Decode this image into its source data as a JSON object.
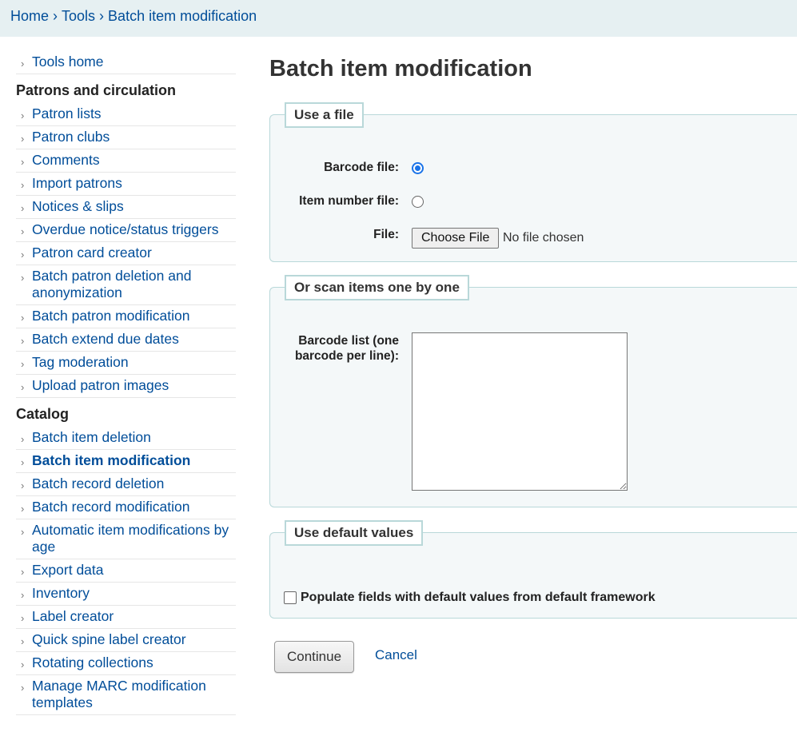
{
  "breadcrumbs": [
    "Home",
    "Tools",
    "Batch item modification"
  ],
  "breadcrumb_separator": "›",
  "sidebar": {
    "tools_home": "Tools home",
    "sections": [
      {
        "heading": "Patrons and circulation",
        "items": [
          "Patron lists",
          "Patron clubs",
          "Comments",
          "Import patrons",
          "Notices & slips",
          "Overdue notice/status triggers",
          "Patron card creator",
          "Batch patron deletion and anonymization",
          "Batch patron modification",
          "Batch extend due dates",
          "Tag moderation",
          "Upload patron images"
        ]
      },
      {
        "heading": "Catalog",
        "items": [
          "Batch item deletion",
          "Batch item modification",
          "Batch record deletion",
          "Batch record modification",
          "Automatic item modifications by age",
          "Export data",
          "Inventory",
          "Label creator",
          "Quick spine label creator",
          "Rotating collections",
          "Manage MARC modification templates"
        ]
      }
    ],
    "active_item": "Batch item modification"
  },
  "page": {
    "title": "Batch item modification",
    "use_file": {
      "legend": "Use a file",
      "barcode_file_label": "Barcode file:",
      "item_number_file_label": "Item number file:",
      "file_label": "File:",
      "choose_file_button": "Choose File",
      "no_file_text": "No file chosen",
      "selected": "barcode"
    },
    "scan": {
      "legend": "Or scan items one by one",
      "barcode_list_label": "Barcode list (one barcode per line):",
      "barcode_list_value": ""
    },
    "defaults": {
      "legend": "Use default values",
      "checkbox_label": "Populate fields with default values from default framework",
      "checked": false
    },
    "continue_button": "Continue",
    "cancel_link": "Cancel"
  },
  "colors": {
    "link": "#004d99",
    "breadcrumb_bg": "#e6f0f2",
    "fieldset_bg": "#f4f8f9",
    "fieldset_border": "#b9d8d9",
    "radio_selected": "#1a73e8"
  }
}
